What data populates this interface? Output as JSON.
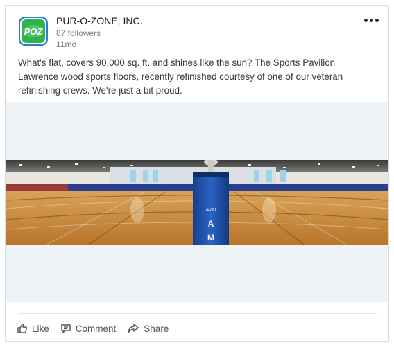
{
  "post": {
    "company": {
      "name": "PUR-O-ZONE, INC.",
      "logo_text": "POZ",
      "followers": "87 followers",
      "time": "11mo"
    },
    "body_lines": [
      "What's flat, covers 90,000 sq. ft. and shines like the sun? The Sports Pavilion",
      "Lawrence wood sports floors, recently refinished courtesy of one of our veteran",
      "refinishing crews. We're just a bit proud."
    ],
    "image": {
      "pad_lettering": [
        "A",
        "M"
      ]
    },
    "actions": {
      "like": "Like",
      "comment": "Comment",
      "share": "Share"
    }
  },
  "colors": {
    "logo_green": "#2db34a",
    "logo_blue": "#2a7fd4",
    "floor": "#c98a3a",
    "wall": "#e8e6df",
    "trim_blue": "#2a3f8f",
    "pad_blue": "#1b4fa8"
  },
  "icons": [
    "more-icon",
    "like-icon",
    "comment-icon",
    "share-icon"
  ]
}
